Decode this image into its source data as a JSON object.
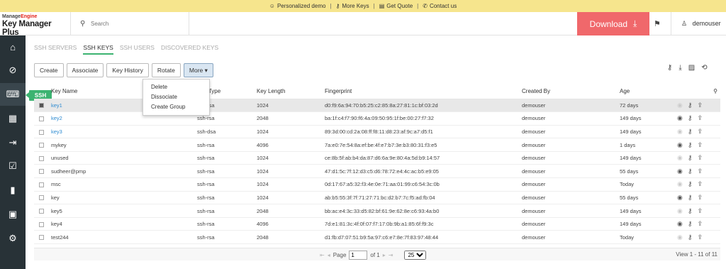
{
  "banner": {
    "personalized_demo": "Personalized demo",
    "more_keys": "More Keys",
    "get_quote": "Get Quote",
    "contact_us": "Contact us"
  },
  "header": {
    "logo_top_prefix": "Manage",
    "logo_top_suffix": "Engine",
    "logo_product": "Key Manager Plus",
    "search_placeholder": "Search",
    "download_label": "Download",
    "username": "demouser"
  },
  "ssh_tooltip": "SSH",
  "tabs": [
    "SSH SERVERS",
    "SSH KEYS",
    "SSH USERS",
    "DISCOVERED KEYS"
  ],
  "active_tab": "SSH KEYS",
  "actions": [
    "Create",
    "Associate",
    "Key History",
    "Rotate",
    "More ▾"
  ],
  "more_menu": [
    "Delete",
    "Dissociate",
    "Create Group"
  ],
  "table": {
    "columns": [
      "Key Name",
      "Key Type",
      "Key Length",
      "Fingerprint",
      "Created By",
      "Age"
    ],
    "rows": [
      {
        "name": "key1",
        "type": "ssh-rsa",
        "length": "1024",
        "fingerprint": "d0:f9:6a:94:70:b5:25:c2:85:8a:27:81:1c:bf:03:2d",
        "created_by": "demouser",
        "age": "72 days",
        "link": true,
        "selected": true
      },
      {
        "name": "key2",
        "type": "ssh-rsa",
        "length": "2048",
        "fingerprint": "ba:1f:c4:f7:90:f6:4a:09:50:95:1f:be:00:27:f7:32",
        "created_by": "demouser",
        "age": "149 days",
        "link": true,
        "selected": false
      },
      {
        "name": "key3",
        "type": "ssh-dsa",
        "length": "1024",
        "fingerprint": "89:3d:00:cd:2a:08:ff:f8:11:d8:23:af:9c:a7:d5:f1",
        "created_by": "demouser",
        "age": "149 days",
        "link": true,
        "selected": false
      },
      {
        "name": "mykey",
        "type": "ssh-rsa",
        "length": "4096",
        "fingerprint": "7a:e0:7e:54:8a:ef:be:4f:e7:b7:3e:b3:80:31:f3:e5",
        "created_by": "demouser",
        "age": "1 days",
        "link": false,
        "selected": false
      },
      {
        "name": "unused",
        "type": "ssh-rsa",
        "length": "1024",
        "fingerprint": "ce:8b:5f:ab:b4:da:87:d6:6a:9e:80:4a:5d:b9:14:57",
        "created_by": "demouser",
        "age": "149 days",
        "link": false,
        "selected": false
      },
      {
        "name": "sudheer@pmp",
        "type": "ssh-rsa",
        "length": "1024",
        "fingerprint": "47:d1:5c:7f:12:d3:c5:d6:78:72:e4:4c:ac:b5:e9:05",
        "created_by": "demouser",
        "age": "55 days",
        "link": false,
        "selected": false
      },
      {
        "name": "msc",
        "type": "ssh-rsa",
        "length": "1024",
        "fingerprint": "0d:17:67:a5:32:f3:4e:0e:71:aa:01:99:c6:54:3c:0b",
        "created_by": "demouser",
        "age": "Today",
        "link": false,
        "selected": false
      },
      {
        "name": "key",
        "type": "ssh-rsa",
        "length": "1024",
        "fingerprint": "ab:b5:55:3f:7f:71:27:71:bc:d2:b7:7c:f5:ad:fb:04",
        "created_by": "demouser",
        "age": "55 days",
        "link": false,
        "selected": false
      },
      {
        "name": "key5",
        "type": "ssh-rsa",
        "length": "2048",
        "fingerprint": "bb:ac:e4:3c:33:d5:82:bf:61:9e:62:8e:c6:93:4a:b0",
        "created_by": "demouser",
        "age": "149 days",
        "link": false,
        "selected": false
      },
      {
        "name": "key4",
        "type": "ssh-rsa",
        "length": "4096",
        "fingerprint": "7d:e1:81:3c:4f:0f:07:f7:17:0b:9b:a1:85:6f:f9:3c",
        "created_by": "demouser",
        "age": "149 days",
        "link": false,
        "selected": false
      },
      {
        "name": "test244",
        "type": "ssh-rsa",
        "length": "2048",
        "fingerprint": "d1:fb:d7:07:51:b9:5a:97:c6:e7:8e:7f:83:97:48:44",
        "created_by": "demouser",
        "age": "Today",
        "link": false,
        "selected": false
      }
    ]
  },
  "pagination": {
    "page_label": "Page",
    "page_value": "1",
    "of_label": "of 1",
    "page_size": "25",
    "view_label": "View 1 - 11 of 11"
  },
  "colors": {
    "accent_green": "#3cb371",
    "download_red": "#f0686b",
    "sidebar_bg": "#283237",
    "banner_bg": "#f6e58d",
    "link_blue": "#2e8bd1"
  }
}
